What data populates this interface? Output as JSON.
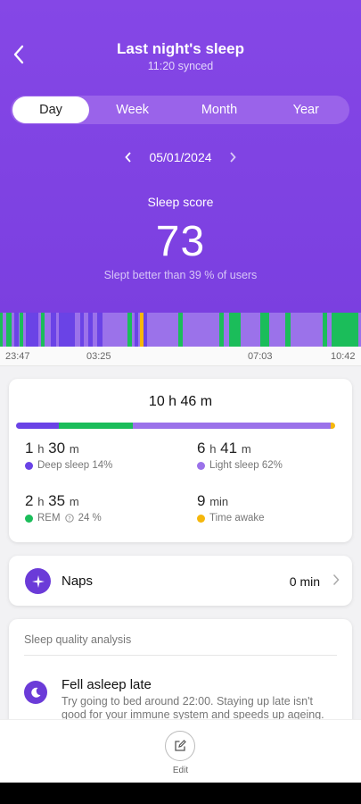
{
  "header": {
    "title": "Last night's sleep",
    "synced": "11:20 synced"
  },
  "tabs": [
    {
      "label": "Day",
      "active": true
    },
    {
      "label": "Week",
      "active": false
    },
    {
      "label": "Month",
      "active": false
    },
    {
      "label": "Year",
      "active": false
    }
  ],
  "date": "05/01/2024",
  "score": {
    "label": "Sleep score",
    "value": "73",
    "subtitle": "Slept better than 39 % of users"
  },
  "timeline": {
    "ticks": [
      "23:47",
      "03:25",
      "07:03",
      "10:42"
    ],
    "colors": {
      "deep": "#6a43e6",
      "light": "#9b72ea",
      "rem": "#1bbd5a",
      "awake": "#f5b70b"
    }
  },
  "summary": {
    "total": "10 h 46 m",
    "deep": {
      "h": "1",
      "m": "30",
      "label": "Deep sleep 14%",
      "pct": 14
    },
    "light": {
      "h": "6",
      "m": "41",
      "label": "Light sleep 62%",
      "pct": 62
    },
    "rem": {
      "h": "2",
      "m": "35",
      "label": "REM",
      "pct_text": "24 %",
      "pct": 24
    },
    "awake": {
      "value": "9",
      "unit": "min",
      "label": "Time awake"
    },
    "unit_h": "h",
    "unit_m": "m"
  },
  "naps": {
    "label": "Naps",
    "value": "0 min"
  },
  "analysis": {
    "header": "Sleep quality analysis",
    "title": "Fell asleep late",
    "description": "Try going to bed around 22:00. Staying up late isn't good for your immune system and speeds up ageing."
  },
  "footer": {
    "edit_label": "Edit"
  }
}
